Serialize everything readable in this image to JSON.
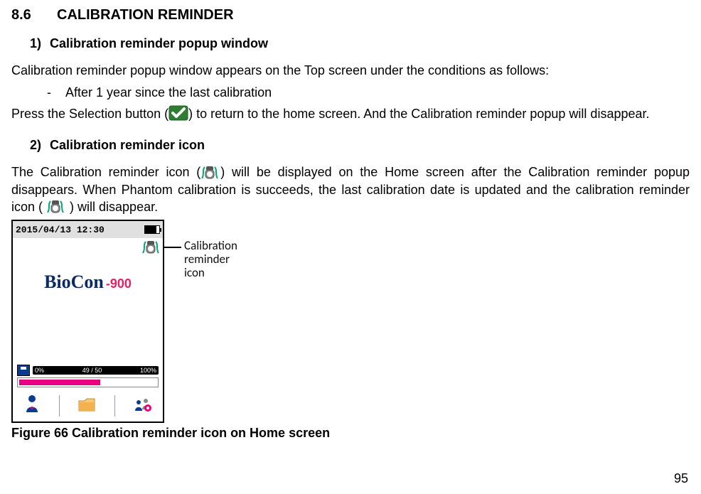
{
  "section": {
    "number": "8.6",
    "title": "CALIBRATION REMINDER"
  },
  "sub1": {
    "number": "1)",
    "title": "Calibration reminder popup window"
  },
  "para1": "Calibration reminder popup window appears on the Top screen under the conditions as follows:",
  "bullet1": "After 1 year since the last calibration",
  "para2_a": "Press the Selection button (",
  "para2_b": ") to return to the home screen. And the Calibration reminder popup will disappear.",
  "sub2": {
    "number": "2)",
    "title": "Calibration reminder icon"
  },
  "para3_a": "The Calibration reminder icon (",
  "para3_b": ") will be displayed on the Home screen after the Calibration reminder popup disappears. When Phantom calibration is succeeds, the last calibration date is updated and the calibration reminder icon ( ",
  "para3_c": " ) will disappear.",
  "device": {
    "datetime": "2015/04/13 12:30",
    "logo_text": "BioCon",
    "logo_suffix": "-900",
    "progress": {
      "left": "0%",
      "mid": "49 / 50",
      "right": "100%"
    }
  },
  "callout": {
    "line1": "Calibration",
    "line2": "reminder",
    "line3": "icon"
  },
  "figure_caption": "Figure 66 Calibration reminder icon on Home screen",
  "page_number": "95"
}
